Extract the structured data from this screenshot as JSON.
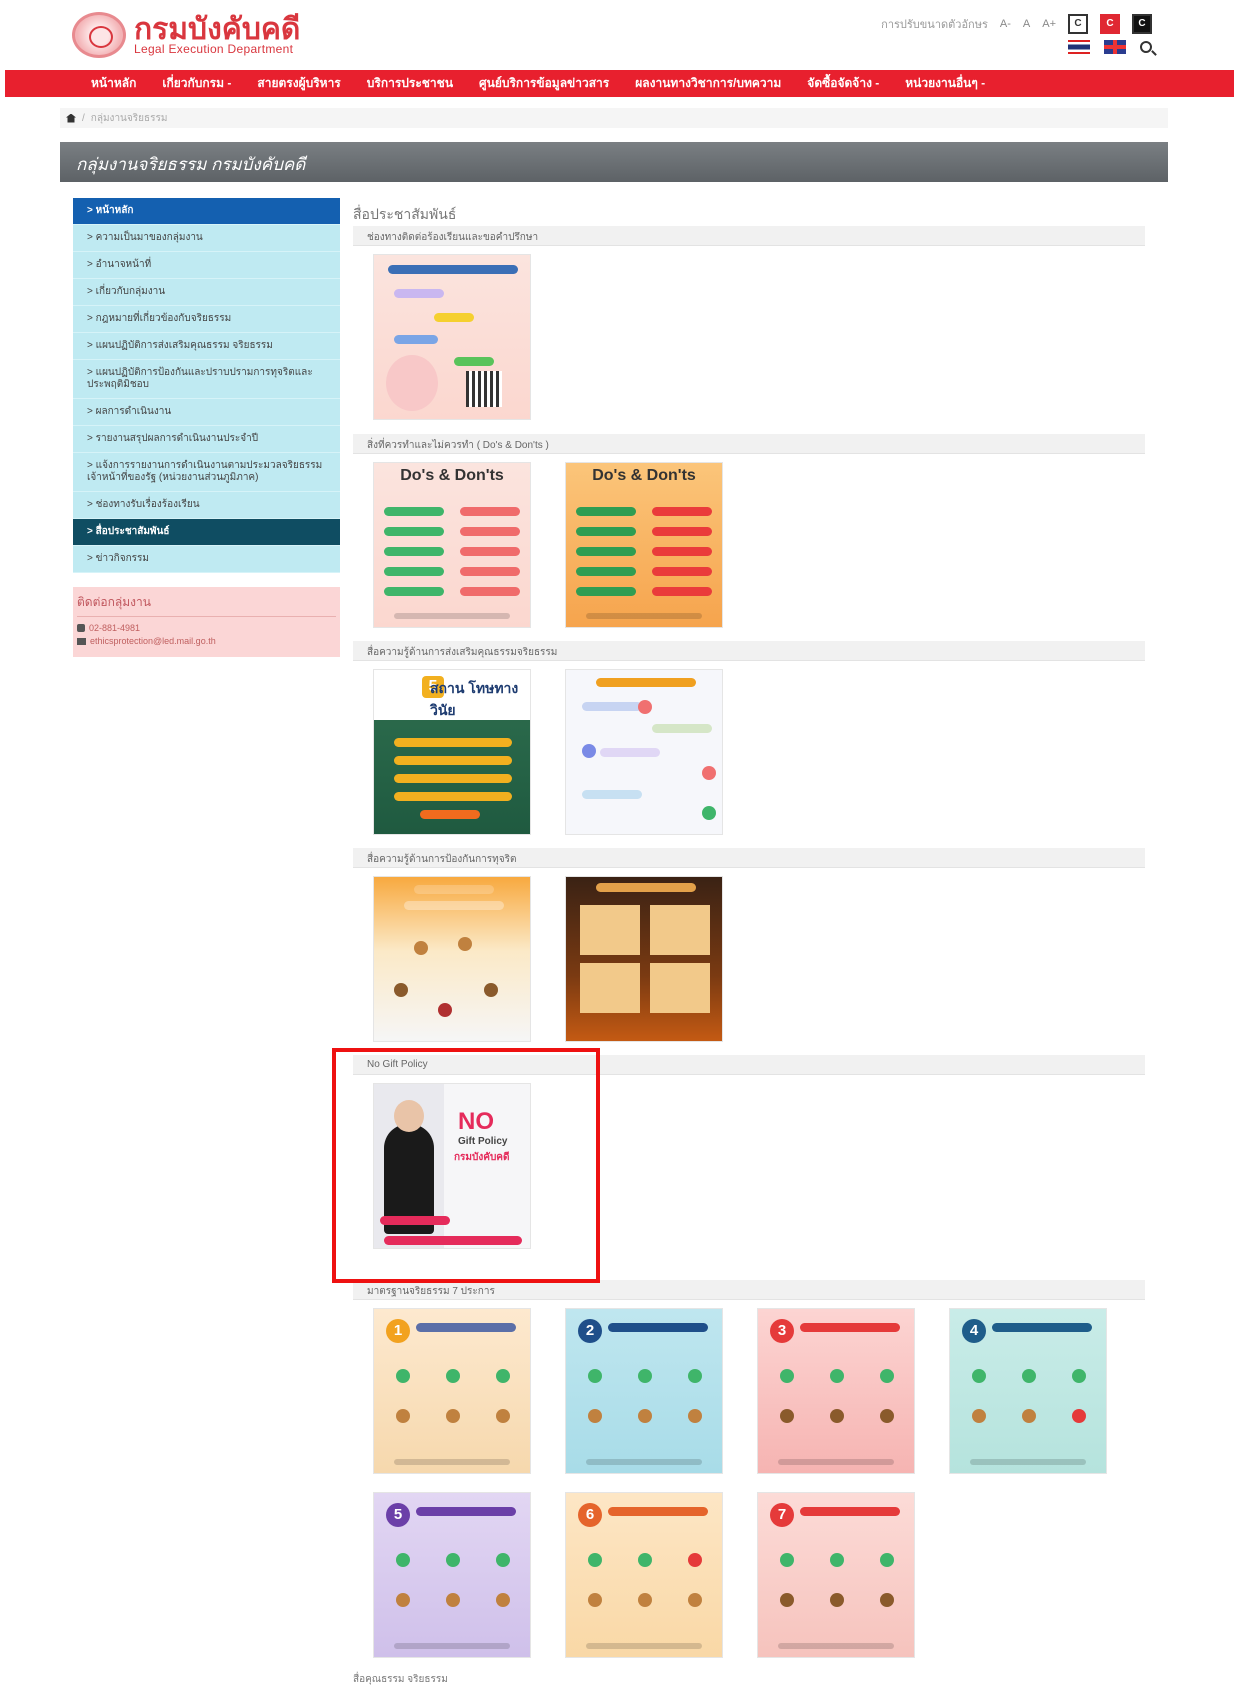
{
  "header": {
    "logo_th": "กรมบังคับคดี",
    "logo_en": "Legal Execution Department",
    "accessibility_label": "การปรับขนาดตัวอักษร",
    "font_small": "A-",
    "font_normal": "A",
    "font_large": "A+",
    "contrast": [
      "C",
      "C",
      "C"
    ]
  },
  "nav": {
    "items": [
      "หน้าหลัก",
      "เกี่ยวกับกรม -",
      "สายตรงผู้บริหาร",
      "บริการประชาชน",
      "ศูนย์บริการข้อมูลข่าวสาร",
      "ผลงานทางวิชาการ/บทความ",
      "จัดซื้อจัดจ้าง -",
      "หน่วยงานอื่นๆ -"
    ]
  },
  "breadcrumb": {
    "current": "กลุ่มงานจริยธรรม"
  },
  "page_title": "กลุ่มงานจริยธรรม กรมบังคับคดี",
  "sidebar": {
    "items": [
      "> หน้าหลัก",
      "> ความเป็นมาของกลุ่มงาน",
      "> อำนาจหน้าที่",
      "> เกี่ยวกับกลุ่มงาน",
      "> กฎหมายที่เกี่ยวข้องกับจริยธรรม",
      "> แผนปฏิบัติการส่งเสริมคุณธรรม จริยธรรม",
      "> แผนปฏิบัติการป้องกันและปราบปรามการทุจริตและประพฤติมิชอบ",
      "> ผลการดำเนินงาน",
      "> รายงานสรุปผลการดำเนินงานประจำปี",
      "> แจ้งการรายงานการดำเนินงานตามประมวลจริยธรรมเจ้าหน้าที่ของรัฐ (หน่วยงานส่วนภูมิภาค)",
      "> ช่องทางรับเรื่องร้องเรียน",
      "> สื่อประชาสัมพันธ์",
      "> ข่าวกิจกรรม"
    ],
    "contact_title": "ติดต่อกลุ่มงาน",
    "contact_phone": "02-881-4981",
    "contact_email": "ethicsprotection@led.mail.go.th"
  },
  "main": {
    "title": "สื่อประชาสัมพันธ์",
    "sections": [
      "ช่องทางติดต่อร้องเรียนและขอคำปรึกษา",
      "สิ่งที่ควรทำและไม่ควรทำ ( Do's & Don'ts )",
      "สื่อความรู้ด้านการส่งเสริมคุณธรรมจริยธรรม",
      "สื่อความรู้ด้านการป้องกันการทุจริต",
      "No Gift Policy",
      "มาตรฐานจริยธรรม 7 ประการ",
      "สื่อคุณธรรม จริยธรรม"
    ],
    "posters": {
      "dos": "Do's & Don'ts",
      "sathan": "สถาน โทษทางวินัย",
      "sathan_num": "5",
      "no_gift_no": "NO",
      "no_gift_line": "Gift Policy",
      "no_gift_dept": "กรมบังคับคดี",
      "num": [
        "1",
        "2",
        "3",
        "4",
        "5",
        "6",
        "7"
      ]
    }
  },
  "colors": {
    "nav_red": "#e8202e",
    "side_blue": "#1460b0",
    "side_dark": "#0f4d62",
    "highlight": "#ee1111"
  }
}
